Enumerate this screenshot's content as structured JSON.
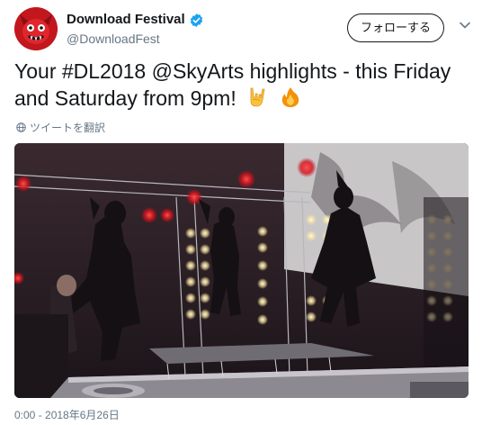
{
  "account": {
    "display_name": "Download Festival",
    "handle": "@DownloadFest",
    "verified": true
  },
  "follow_button": {
    "label": "フォローする"
  },
  "tweet": {
    "text": "Your #DL2018 @SkyArts highlights - this Friday and Saturday from 9pm!",
    "emojis": [
      "sign-of-the-horns",
      "fire"
    ]
  },
  "translate_link": {
    "label": "ツイートを翻訳",
    "icon": "globe-icon"
  },
  "meta": {
    "timestamp": "0:00 - 2018年6月26日"
  },
  "colors": {
    "accent": "#1da1f2",
    "text": "#14171a",
    "muted": "#657786",
    "avatar_bg": "#c2171d"
  }
}
